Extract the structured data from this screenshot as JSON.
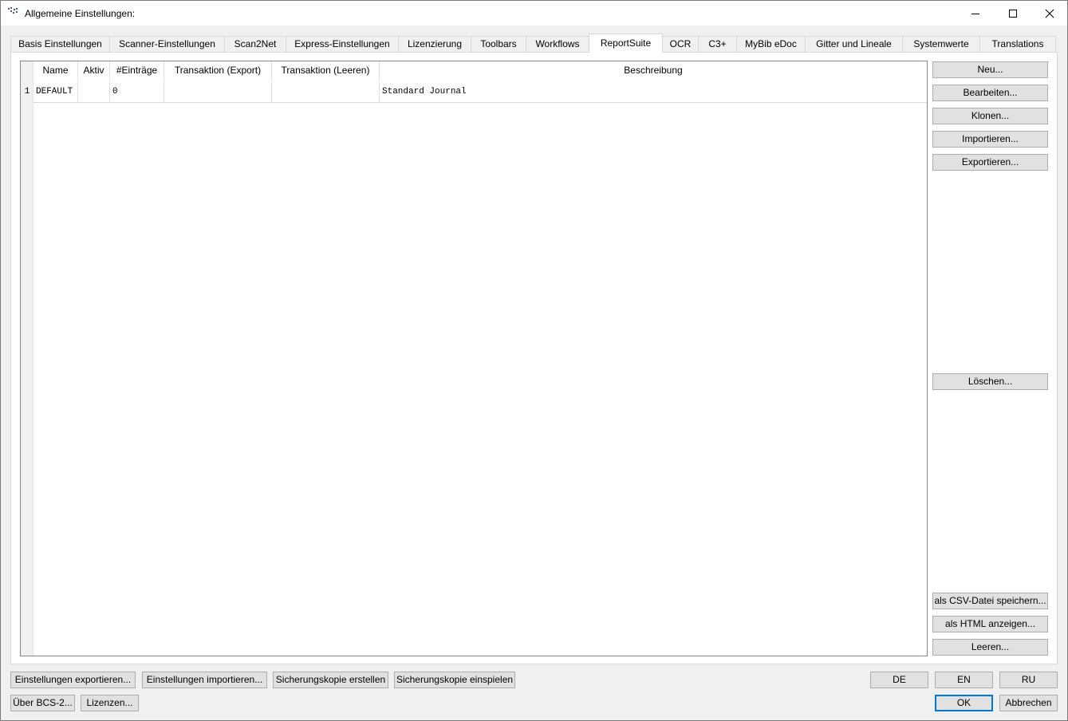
{
  "window": {
    "title": "Allgemeine Einstellungen:"
  },
  "tabs": [
    "Basis Einstellungen",
    "Scanner-Einstellungen",
    "Scan2Net",
    "Express-Einstellungen",
    "Lizenzierung",
    "Toolbars",
    "Workflows",
    "ReportSuite",
    "OCR",
    "C3+",
    "MyBib eDoc",
    "Gitter und Lineale",
    "Systemwerte",
    "Translations"
  ],
  "active_tab": "ReportSuite",
  "table": {
    "headers": [
      "Name",
      "Aktiv",
      "#Einträge",
      "Transaktion (Export)",
      "Transaktion (Leeren)",
      "Beschreibung"
    ],
    "rows": [
      {
        "num": "1",
        "name": "DEFAULT",
        "aktiv": "",
        "eintraege": "0",
        "export": "",
        "leeren": "",
        "beschreibung": "Standard Journal"
      }
    ]
  },
  "side_buttons": {
    "neu": "Neu...",
    "bearbeiten": "Bearbeiten...",
    "klonen": "Klonen...",
    "importieren": "Importieren...",
    "exportieren": "Exportieren...",
    "loeschen": "Löschen...",
    "csv": "als CSV-Datei speichern...",
    "html": "als HTML anzeigen...",
    "leeren": "Leeren..."
  },
  "bottom_buttons": {
    "settings_export": "Einstellungen exportieren...",
    "settings_import": "Einstellungen importieren...",
    "backup_create": "Sicherungskopie erstellen",
    "backup_restore": "Sicherungskopie einspielen",
    "about": "Über BCS-2...",
    "licenses": "Lizenzen...",
    "lang_de": "DE",
    "lang_en": "EN",
    "lang_ru": "RU",
    "ok": "OK",
    "cancel": "Abbrechen"
  },
  "colors": {
    "accent": "#0078d7",
    "button_bg": "#e1e1e1",
    "window_bg": "#f0f0f0"
  }
}
